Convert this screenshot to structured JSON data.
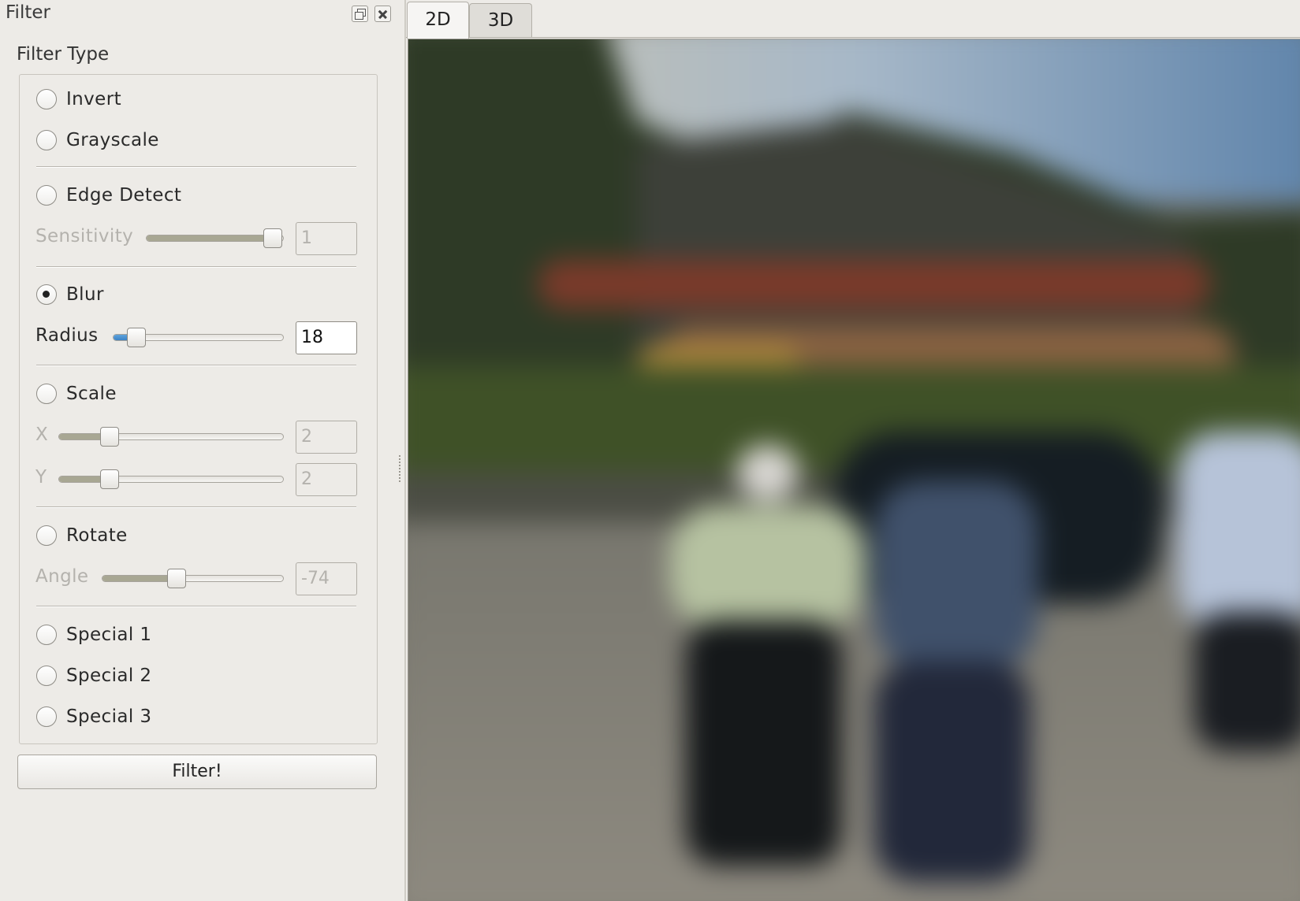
{
  "dock": {
    "title": "Filter",
    "float_button": "float-button",
    "close_button": "close-button"
  },
  "filter_group": {
    "title": "Filter Type",
    "options": {
      "invert": "Invert",
      "grayscale": "Grayscale",
      "edge_detect": "Edge Detect",
      "blur": "Blur",
      "scale": "Scale",
      "rotate": "Rotate",
      "special1": "Special 1",
      "special2": "Special 2",
      "special3": "Special 3"
    },
    "selected": "Blur",
    "params": {
      "sensitivity": {
        "label": "Sensitivity",
        "value": "1",
        "fraction": 0.99,
        "enabled": false
      },
      "radius": {
        "label": "Radius",
        "value": "18",
        "fraction": 0.09,
        "enabled": true
      },
      "scale_x": {
        "label": "X",
        "value": "2",
        "fraction": 0.2,
        "enabled": false
      },
      "scale_y": {
        "label": "Y",
        "value": "2",
        "fraction": 0.2,
        "enabled": false
      },
      "angle": {
        "label": "Angle",
        "value": "-74",
        "fraction": 0.4,
        "enabled": false
      }
    }
  },
  "filter_button": "Filter!",
  "tabs": [
    "2D",
    "3D"
  ],
  "active_tab": "2D",
  "colors": {
    "panel_bg": "#edebe7",
    "slider_active": "#3b83c6",
    "slider_inactive": "#a8a793"
  }
}
